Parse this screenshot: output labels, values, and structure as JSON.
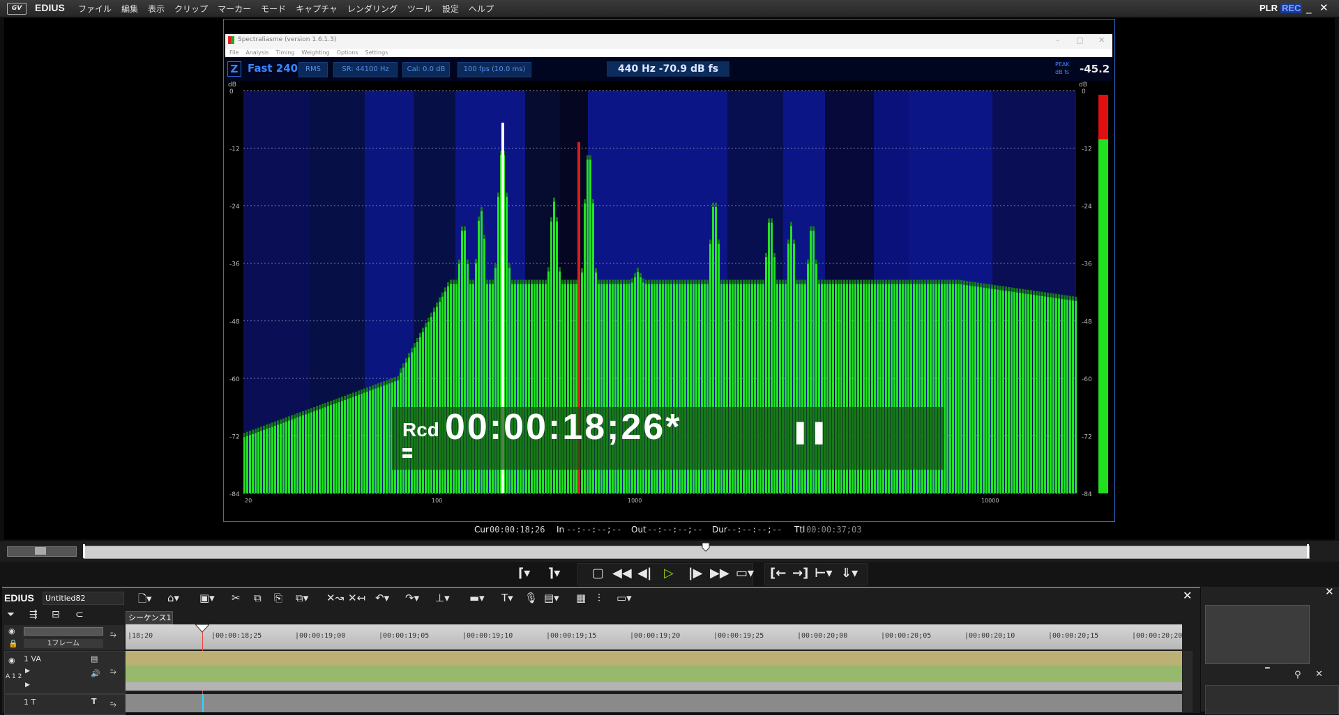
{
  "menubar": {
    "logo": "GV",
    "app_name": "EDIUS",
    "items": [
      "ファイル",
      "編集",
      "表示",
      "クリップ",
      "マーカー",
      "モード",
      "キャプチャ",
      "レンダリング",
      "ツール",
      "設定",
      "ヘルプ"
    ],
    "plr": "PLR",
    "rec": "REC",
    "minimize": "_",
    "close": "✕"
  },
  "analyzer": {
    "window_title": "Spectraliasme (version 1.6.1.3)",
    "menu": [
      "File",
      "Analysis",
      "Timing",
      "Weighting",
      "Options",
      "Settings"
    ],
    "z_button": "Z",
    "speed": "Fast 240",
    "buttons": [
      "RMS",
      "SR: 44100 Hz",
      "Cal: 0.0 dB",
      "100 fps (10.0 ms)"
    ],
    "readout": "440 Hz  -70.9 dB fs",
    "peak_label": "PEAK",
    "peak_unit": "dB fs",
    "peak_value": "-45.2",
    "db_unit": "dB",
    "y_ticks": [
      "0",
      "-12",
      "-24",
      "-36",
      "-48",
      "-60",
      "-72",
      "-84"
    ],
    "x_ticks": [
      "20",
      "100",
      "1000",
      "10000"
    ]
  },
  "overlay": {
    "mode": "Rcd",
    "timecode": "00:00:18;26*",
    "pause": "❚❚"
  },
  "tcbar": {
    "cur_label": "Cur",
    "cur": "00:00:18;26",
    "in_label": "In",
    "in": "--:--:--;--",
    "out_label": "Out",
    "out": "--:--:--;--",
    "dur_label": "Dur",
    "dur": "--:--:--;--",
    "ttl_label": "Ttl",
    "ttl": "00:00:37;03"
  },
  "timeline": {
    "app": "EDIUS",
    "project_name": "Untitled82",
    "sequence_tab": "シーケンス1",
    "frame_select": "1フレーム",
    "ruler_ticks": [
      "18;20",
      "00:00:18;25",
      "00:00:19;00",
      "00:00:19;05",
      "00:00:19;10",
      "00:00:19;15",
      "00:00:19;20",
      "00:00:19;25",
      "00:00:20;00",
      "00:00:20;05",
      "00:00:20;10",
      "00:00:20;15",
      "00:00:20;20"
    ],
    "track_va": "1 VA",
    "track_t": "1 T",
    "track_va_lock": "A 1 2"
  },
  "colors": {
    "accent": "#2d6fd6",
    "spectrum_green": "#22e322",
    "play_green": "#8ed81a"
  }
}
